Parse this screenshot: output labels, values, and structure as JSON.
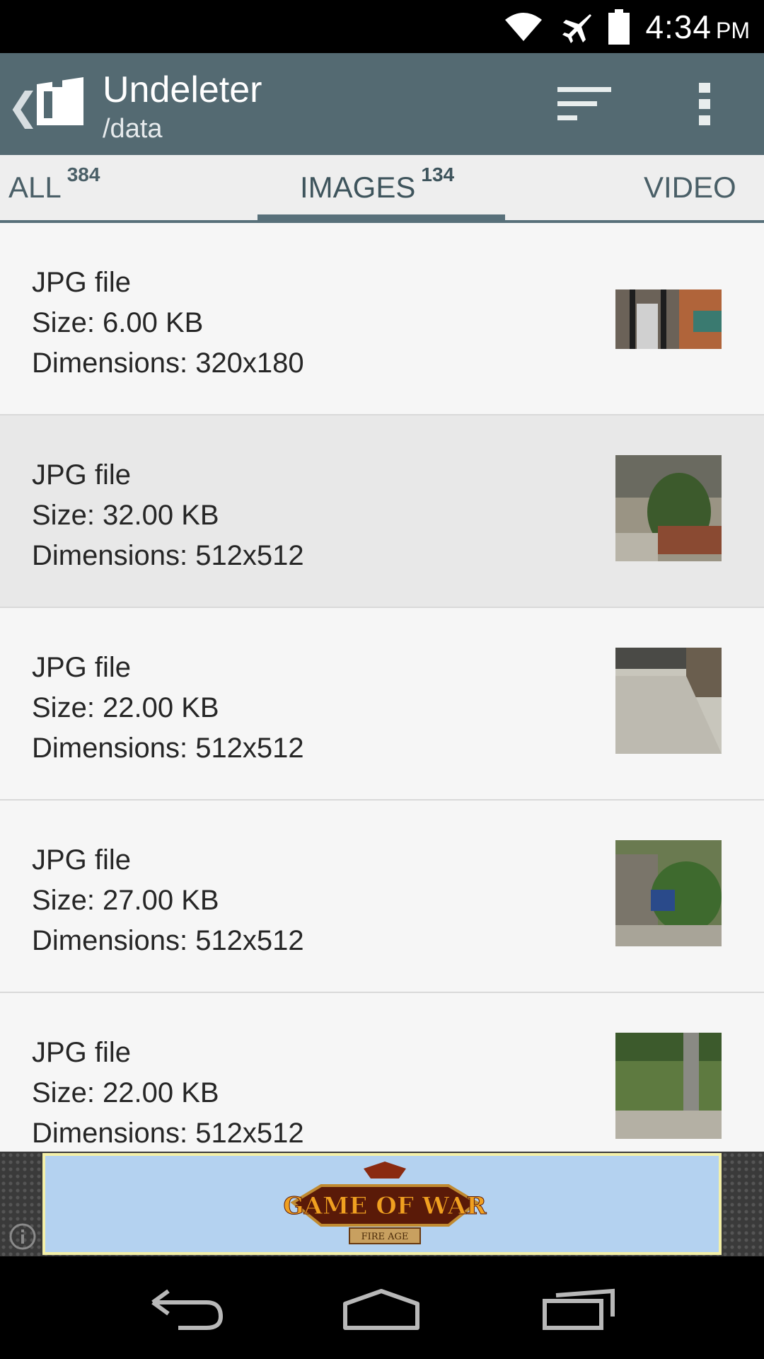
{
  "status": {
    "time": "4:34",
    "ampm": "PM"
  },
  "app": {
    "title": "Undeleter",
    "subtitle": "/data"
  },
  "tabs": [
    {
      "label": "ALL",
      "count": "384"
    },
    {
      "label": "IMAGES",
      "count": "134"
    },
    {
      "label": "VIDEO"
    }
  ],
  "files": [
    {
      "type": "JPG file",
      "size": "Size: 6.00 KB",
      "dims": "Dimensions: 320x180"
    },
    {
      "type": "JPG file",
      "size": "Size: 32.00 KB",
      "dims": "Dimensions: 512x512"
    },
    {
      "type": "JPG file",
      "size": "Size: 22.00 KB",
      "dims": "Dimensions: 512x512"
    },
    {
      "type": "JPG file",
      "size": "Size: 27.00 KB",
      "dims": "Dimensions: 512x512"
    },
    {
      "type": "JPG file",
      "size": "Size: 22.00 KB",
      "dims": "Dimensions: 512x512"
    }
  ],
  "ad": {
    "logo_text": "GAME OF WAR",
    "logo_subtext": "FIRE AGE"
  },
  "colors": {
    "app_bar": "#546a72",
    "tab_indicator": "#58707a",
    "ad_background": "#b4d2f0"
  }
}
